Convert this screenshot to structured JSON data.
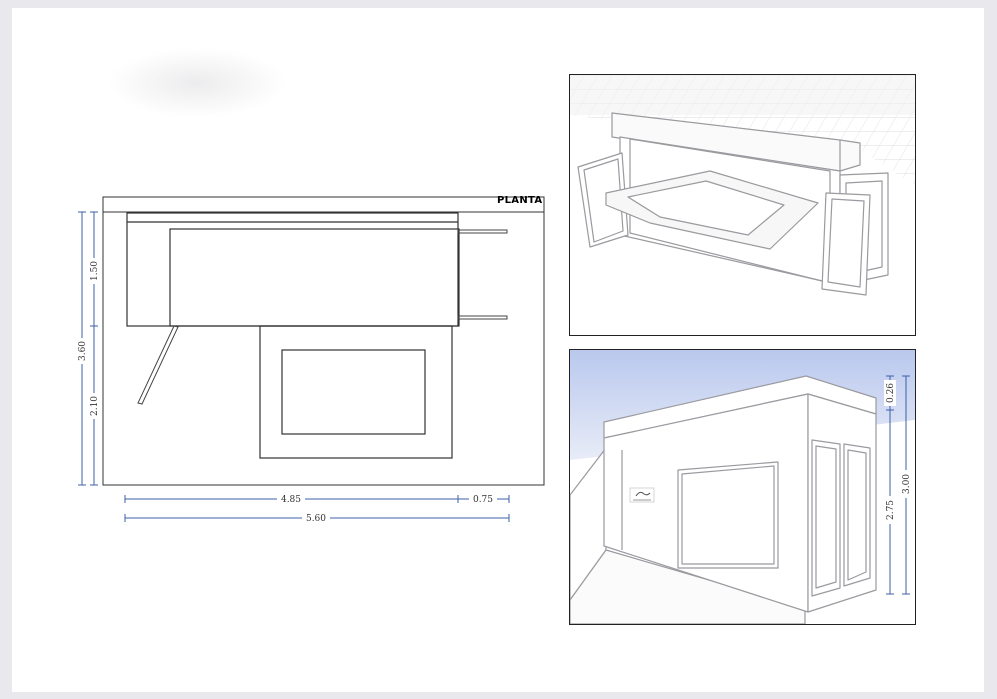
{
  "plan": {
    "title": "PLANTA",
    "dims": {
      "total_height": "3.60",
      "upper_height": "1.50",
      "lower_height": "2.10",
      "main_length": "4.85",
      "extension": "0.75",
      "total_length": "5.60"
    }
  },
  "elevation": {
    "dims": {
      "roof_band": "0.26",
      "wall_height": "2.75",
      "total_height": "3.00"
    }
  },
  "colors": {
    "dimension_line": "#3d5fa8",
    "sky": "#c9d6f1",
    "outline": "#222222"
  }
}
